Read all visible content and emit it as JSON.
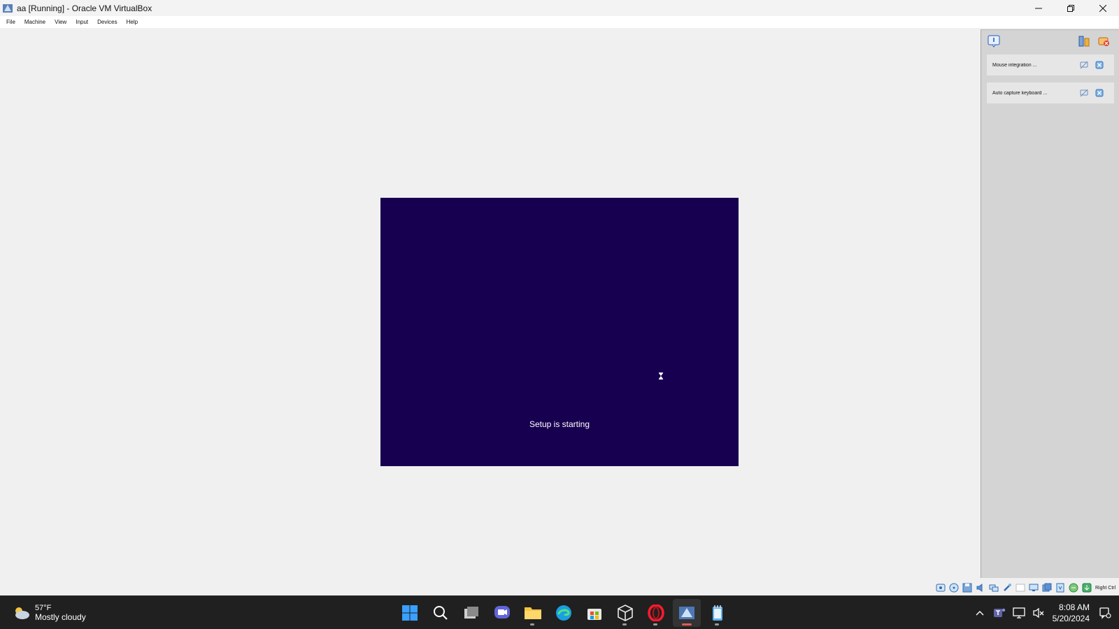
{
  "window": {
    "title": "aa [Running] - Oracle VM VirtualBox",
    "app_icon": "virtualbox-icon",
    "controls": [
      "minimize-icon",
      "restore-icon",
      "close-icon"
    ]
  },
  "menu": {
    "items": [
      "File",
      "Machine",
      "View",
      "Input",
      "Devices",
      "Help"
    ]
  },
  "vm": {
    "screen_color": "#170050",
    "status_text": "Setup is starting"
  },
  "notifications": {
    "items": [
      {
        "label": "Mouse integration ..."
      },
      {
        "label": "Auto capture keyboard ..."
      }
    ]
  },
  "statusbar": {
    "icons": [
      "hard-disk-icon",
      "optical-drive-icon",
      "floppy-icon",
      "audio-icon",
      "network-icon",
      "usb-icon",
      "shared-folders-icon",
      "display-icon",
      "recording-icon",
      "cpu-icon",
      "vtx-icon",
      "mouse-integration-icon",
      "keyboard-capture-icon"
    ],
    "host_key": "Right Ctrl"
  },
  "taskbar": {
    "weather": {
      "temp": "57°F",
      "condition": "Mostly cloudy"
    },
    "apps": [
      "start-icon",
      "search-icon",
      "task-view-icon",
      "chat-icon",
      "file-explorer-icon",
      "edge-icon",
      "store-icon",
      "virtualbox-manager-icon",
      "opera-icon",
      "virtualbox-vm-icon",
      "notepad-icon"
    ],
    "time": "8:08 AM",
    "date": "5/20/2024"
  },
  "colors": {
    "vm_screen": "#170050",
    "taskbar": "#202020",
    "windows_blue": "#0078d4"
  }
}
